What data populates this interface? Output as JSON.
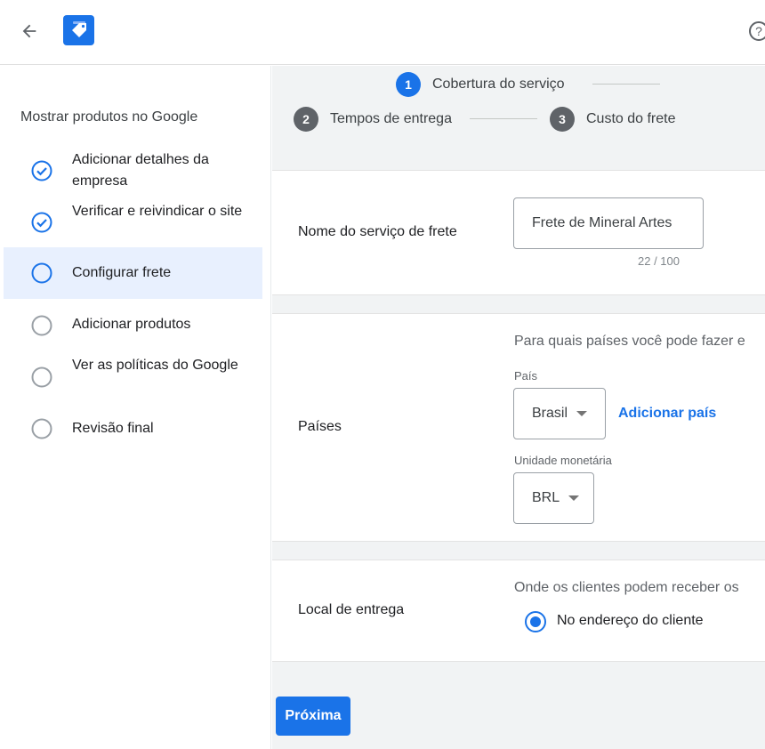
{
  "header": {
    "help_glyph": "?",
    "icons": {
      "back": "back-arrow-icon",
      "logo": "shopping-tag-icon",
      "help": "help-circle-icon"
    }
  },
  "sidebar": {
    "title": "Mostrar produtos no Google",
    "steps": [
      {
        "label": "Adicionar detalhes da empresa",
        "status": "done"
      },
      {
        "label": "Verificar e reivindicar o site",
        "status": "done"
      },
      {
        "label": "Configurar frete",
        "status": "current"
      },
      {
        "label": "Adicionar produtos",
        "status": "todo"
      },
      {
        "label": "Ver as políticas do Google",
        "status": "todo"
      },
      {
        "label": "Revisão final",
        "status": "todo"
      }
    ]
  },
  "stepper": {
    "steps": [
      {
        "number": "1",
        "label": "Cobertura do serviço",
        "state": "active"
      },
      {
        "number": "2",
        "label": "Tempos de entrega",
        "state": "inactive"
      },
      {
        "number": "3",
        "label": "Custo do frete",
        "state": "inactive"
      }
    ]
  },
  "service_name": {
    "label": "Nome do serviço de frete",
    "value": "Frete de Mineral Artes",
    "char_count": "22 / 100"
  },
  "countries": {
    "label": "Países",
    "prompt": "Para quais países você pode fazer e",
    "country_caption": "País",
    "country_value": "Brasil",
    "add_country": "Adicionar país",
    "currency_caption": "Unidade monetária",
    "currency_value": "BRL"
  },
  "delivery": {
    "label": "Local de entrega",
    "prompt": "Onde os clientes podem receber os",
    "option": "No endereço do cliente",
    "selected": true
  },
  "actions": {
    "next": "Próxima"
  },
  "colors": {
    "accent": "#1a73e8",
    "active_step_bg": "#e8f0fe",
    "main_bg": "#f1f3f4"
  }
}
